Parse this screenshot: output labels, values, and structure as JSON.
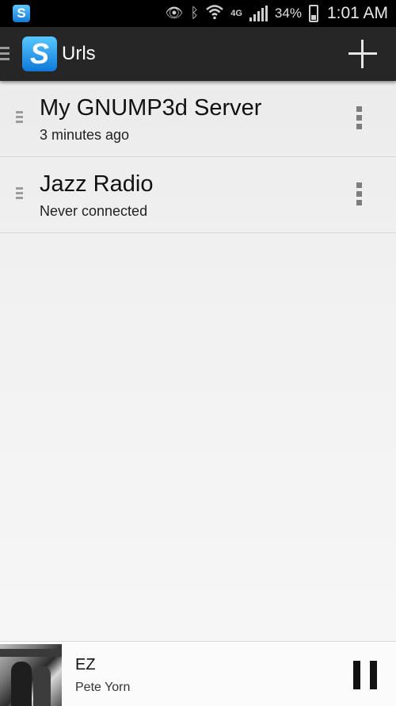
{
  "status_bar": {
    "app_icon_letter": "S",
    "network_label": "4G",
    "battery_percent": "34%",
    "time": "1:01 AM",
    "icons": [
      "eye-icon",
      "bluetooth-icon",
      "wifi-icon",
      "signal-icon",
      "battery-icon"
    ]
  },
  "action_bar": {
    "logo_letter": "S",
    "title": "Urls"
  },
  "urls": [
    {
      "name": "My GNUMP3d Server",
      "status": "3 minutes ago"
    },
    {
      "name": "Jazz Radio",
      "status": "Never connected"
    }
  ],
  "now_playing": {
    "title": "EZ",
    "artist": "Pete Yorn"
  },
  "colors": {
    "action_bar": "#262626",
    "status_bar": "#000000",
    "logo_blue": "#1579d6"
  }
}
